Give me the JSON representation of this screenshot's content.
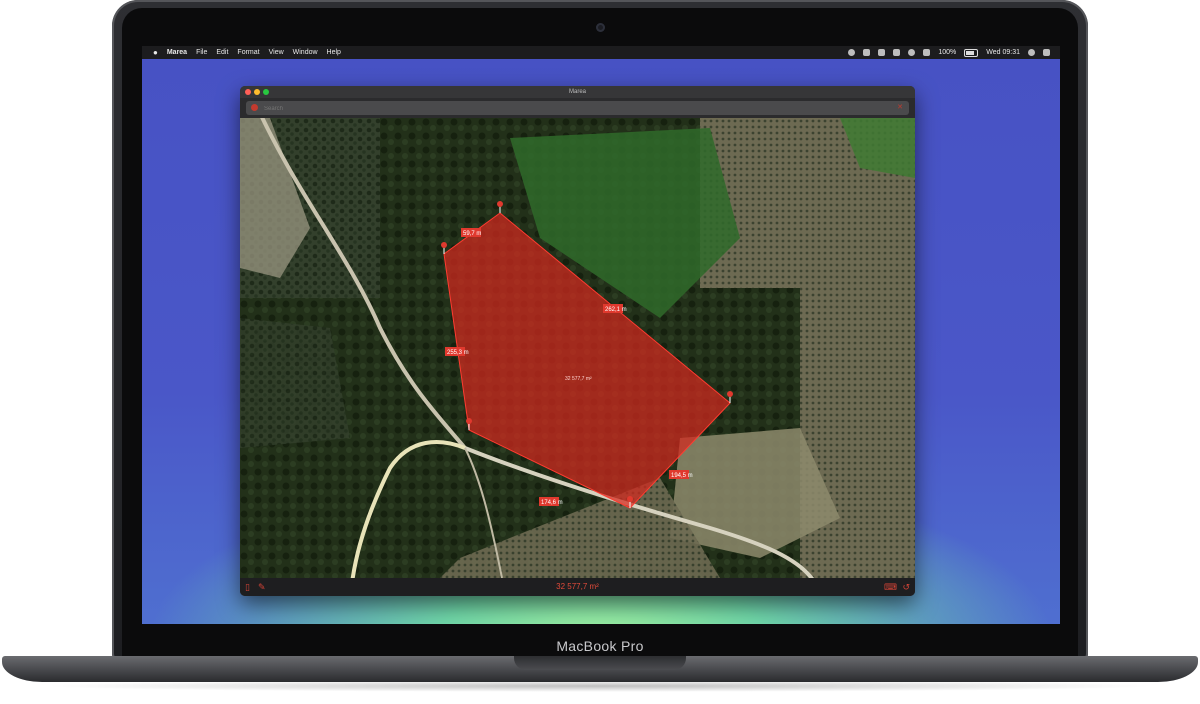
{
  "device": {
    "label": "MacBook Pro"
  },
  "menubar": {
    "apple_icon": "apple-icon",
    "app_name": "Marea",
    "menus": [
      "File",
      "Edit",
      "Format",
      "View",
      "Window",
      "Help"
    ],
    "battery_percent": "100%",
    "clock": "Wed 09:31"
  },
  "window": {
    "title": "Marea",
    "traffic_colors": [
      "#ff5f57",
      "#febc2e",
      "#28c840"
    ]
  },
  "search": {
    "placeholder": "Search"
  },
  "map": {
    "polygon_color": "#d4281e",
    "edge_labels": [
      "59,7 m",
      "262,1 m",
      "255,3 m",
      "194,5 m",
      "174,6 m"
    ],
    "area_label": "32 577,7 m²"
  },
  "footer": {
    "area": "32 577,7 m²",
    "icons": [
      "document-icon",
      "pencil-icon",
      "ruler-icon",
      "undo-icon"
    ]
  }
}
